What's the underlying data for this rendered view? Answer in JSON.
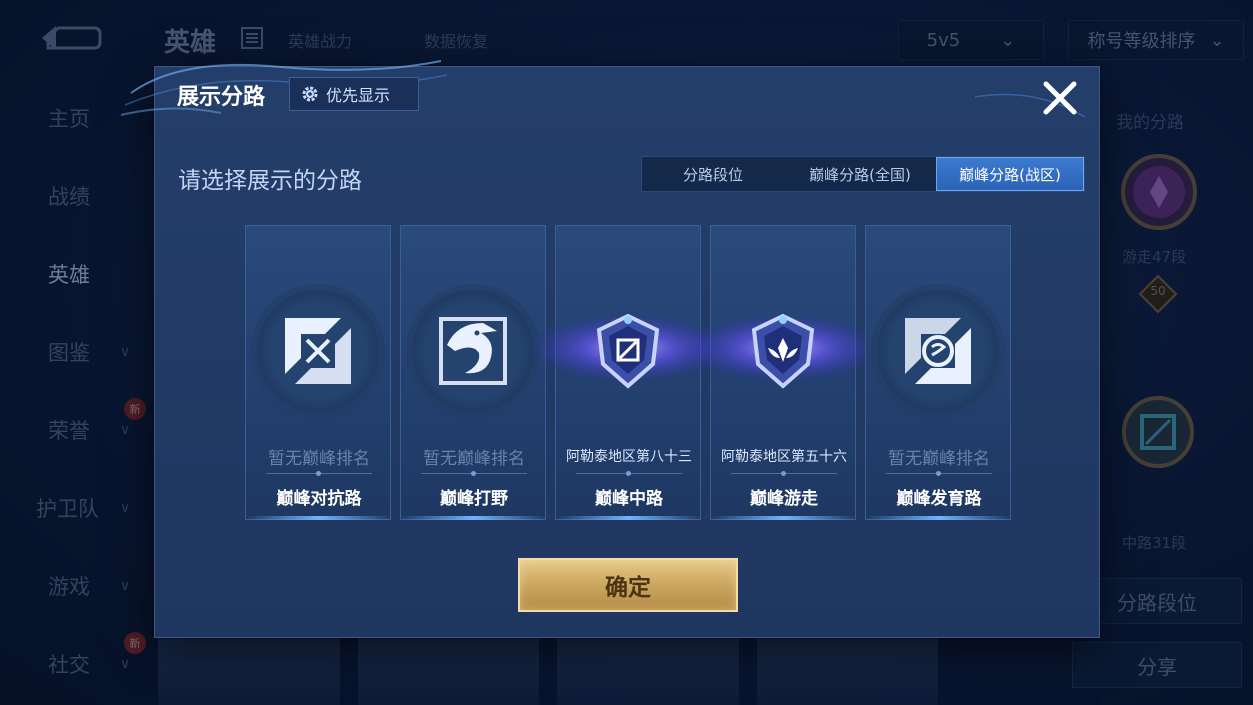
{
  "background": {
    "title": "英雄",
    "tabs": [
      "英雄战力",
      "数据恢复"
    ],
    "mode_select": "5v5",
    "sort_select": "称号等级排序",
    "sidebar": [
      {
        "label": "主页",
        "chevron": false,
        "badge": ""
      },
      {
        "label": "战绩",
        "chevron": false,
        "badge": ""
      },
      {
        "label": "英雄",
        "chevron": false,
        "badge": "",
        "active": true
      },
      {
        "label": "图鉴",
        "chevron": true,
        "badge": ""
      },
      {
        "label": "荣誉",
        "chevron": true,
        "badge": "新"
      },
      {
        "label": "护卫队",
        "chevron": true,
        "badge": ""
      },
      {
        "label": "游戏",
        "chevron": true,
        "badge": ""
      },
      {
        "label": "社交",
        "chevron": true,
        "badge": "新"
      }
    ],
    "right_panel": {
      "title": "我的分路",
      "lane1_label": "游走47段",
      "lane1_level": "50",
      "lane2_label": "中路31段",
      "button1": "分路段位",
      "button2": "分享"
    }
  },
  "modal": {
    "title": "展示分路",
    "priority_button": "优先显示",
    "subtitle": "请选择展示的分路",
    "segments": [
      {
        "label": "分路段位",
        "active": false
      },
      {
        "label": "巅峰分路(全国)",
        "active": false
      },
      {
        "label": "巅峰分路(战区)",
        "active": true
      }
    ],
    "lanes": [
      {
        "name": "巅峰对抗路",
        "rank": "暂无巅峰排名",
        "ranked": false,
        "icon": "clash-lane-icon"
      },
      {
        "name": "巅峰打野",
        "rank": "暂无巅峰排名",
        "ranked": false,
        "icon": "jungle-icon"
      },
      {
        "name": "巅峰中路",
        "rank": "阿勒泰地区第八十三",
        "ranked": true,
        "icon": "mid-lane-badge-icon"
      },
      {
        "name": "巅峰游走",
        "rank": "阿勒泰地区第五十六",
        "ranked": true,
        "icon": "roam-badge-icon"
      },
      {
        "name": "巅峰发育路",
        "rank": "暂无巅峰排名",
        "ranked": false,
        "icon": "farm-lane-icon"
      }
    ],
    "confirm_button": "确定"
  },
  "colors": {
    "accent_blue": "#2b63b6",
    "gold": "#c9a35b",
    "panel": "#243e6b"
  }
}
